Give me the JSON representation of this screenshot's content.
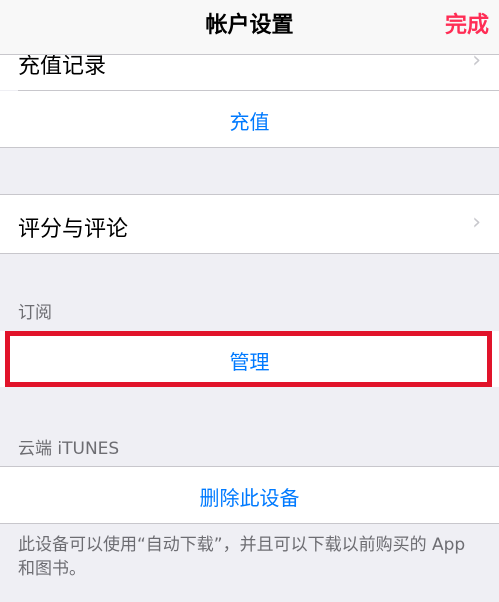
{
  "nav": {
    "title": "帐户设置",
    "done": "完成"
  },
  "rows": {
    "purchase_history": "充值记录",
    "topup": "充值",
    "ratings_reviews": "评分与评论",
    "manage": "管理",
    "remove_device": "删除此设备"
  },
  "sections": {
    "subscriptions": "订阅",
    "itunes_cloud": "云端 iTUNES"
  },
  "footer": {
    "note": "此设备可以使用“自动下载”，并且可以下载以前购买的 App 和图书。"
  },
  "icons": {
    "chevron": "›"
  },
  "colors": {
    "accent": "#007aff",
    "done": "#ff2d55",
    "highlight": "#e1132a"
  }
}
